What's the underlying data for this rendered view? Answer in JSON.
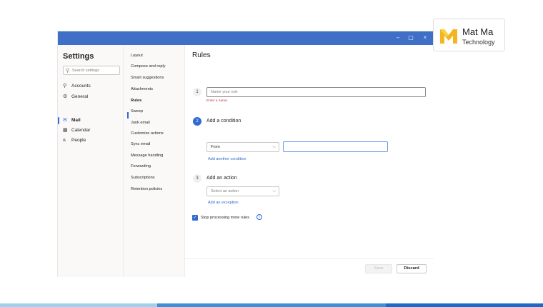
{
  "colors": {
    "titlebar": "#3f6fc7",
    "accent": "#2f6bd0",
    "error": "#c4314b",
    "bar_light": "#9fd0ee",
    "bar_mid": "#3d8fd8",
    "bar_dark": "#1b6ac9"
  },
  "window_controls": {
    "minimize": "–",
    "maximize": "▢",
    "close": "×"
  },
  "settings": {
    "title": "Settings",
    "search_placeholder": "Search settings",
    "nav": [
      {
        "label": "Accounts",
        "icon": "person-icon",
        "glyph": "⚲"
      },
      {
        "label": "General",
        "icon": "gear-icon",
        "glyph": "⚙"
      },
      {
        "label": "Mail",
        "icon": "mail-icon",
        "glyph": "✉"
      },
      {
        "label": "Calendar",
        "icon": "calendar-icon",
        "glyph": "▦"
      },
      {
        "label": "People",
        "icon": "people-icon",
        "glyph": "ጰ"
      }
    ]
  },
  "mail_subnav": [
    "Layout",
    "Compose and reply",
    "Smart suggestions",
    "Attachments",
    "Rules",
    "Sweep",
    "Junk email",
    "Customize actions",
    "Sync email",
    "Message handling",
    "Forwarding",
    "Subscriptions",
    "Retention policies"
  ],
  "rules": {
    "title": "Rules",
    "step1": {
      "number": "1",
      "name_placeholder": "Name your rule",
      "error": "Enter a name."
    },
    "step2": {
      "number": "2",
      "label": "Add a condition",
      "condition_value": "From",
      "add_link": "Add another condition"
    },
    "step3": {
      "number": "3",
      "label": "Add an action",
      "action_placeholder": "Select an action",
      "add_link": "Add an exception"
    },
    "stop_processing": {
      "label": "Stop processing more rules",
      "checked": true
    },
    "buttons": {
      "save": "Save",
      "discard": "Discard"
    }
  },
  "logo": {
    "line1": "Mat Ma",
    "line2": "Technology"
  }
}
